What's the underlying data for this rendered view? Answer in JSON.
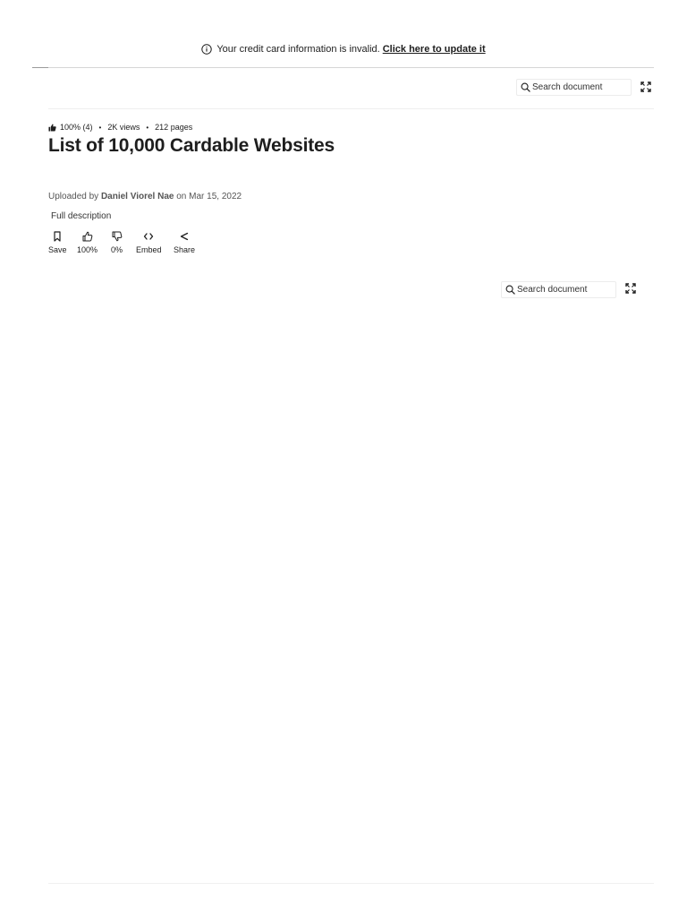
{
  "banner": {
    "message": "Your credit card information is invalid.",
    "link_label": "Click here to update it"
  },
  "toolbar_top": {
    "search_placeholder": "Search document"
  },
  "document": {
    "rating": "100% (4)",
    "views": "2K views",
    "pages": "212 pages",
    "title": "List of 10,000 Cardable Websites",
    "uploaded_by_prefix": "Uploaded by",
    "author": "Daniel Viorel Nae",
    "uploaded_on": "on Mar 15, 2022",
    "full_description_label": "Full description"
  },
  "actions": {
    "save": "Save",
    "like": "100%",
    "dislike": "0%",
    "embed": "Embed",
    "share": "Share"
  },
  "toolbar_viewer": {
    "search_placeholder": "Search document"
  },
  "icons": {
    "info": "info-icon",
    "search": "search-icon",
    "fullscreen": "fullscreen-icon",
    "thumbs_up_filled": "thumbs-up-filled-icon",
    "bookmark": "bookmark-icon",
    "thumbs_up": "thumbs-up-icon",
    "thumbs_down": "thumbs-down-icon",
    "code": "code-icon",
    "share": "share-icon"
  }
}
